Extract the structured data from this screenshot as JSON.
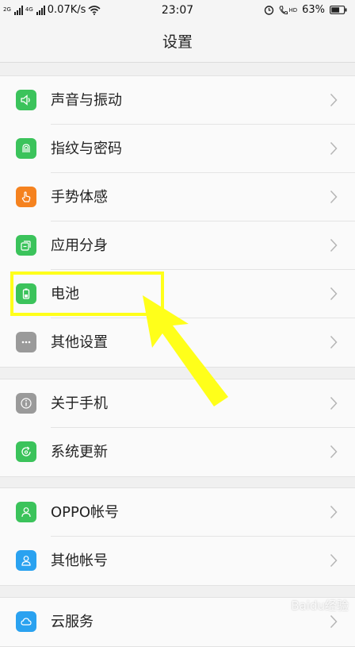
{
  "status_bar": {
    "net_small_1": "2G",
    "net_small_2": "4G",
    "speed": "0.07K/s",
    "time": "23:07",
    "battery": "63%",
    "hd_label": "HD"
  },
  "header": {
    "title": "设置"
  },
  "groups": [
    {
      "items": [
        {
          "label": "声音与振动",
          "icon": "speaker-icon",
          "color": "#3bc35b"
        },
        {
          "label": "指纹与密码",
          "icon": "fingerprint-icon",
          "color": "#3bc35b"
        },
        {
          "label": "手势体感",
          "icon": "gesture-hand-icon",
          "color": "#f5821f"
        },
        {
          "label": "应用分身",
          "icon": "app-clone-icon",
          "color": "#3bc35b"
        },
        {
          "label": "电池",
          "icon": "battery-icon",
          "color": "#3bc35b"
        },
        {
          "label": "其他设置",
          "icon": "more-dots-icon",
          "color": "#9a9a9a"
        }
      ]
    },
    {
      "items": [
        {
          "label": "关于手机",
          "icon": "info-icon",
          "color": "#9a9a9a"
        },
        {
          "label": "系统更新",
          "icon": "system-update-icon",
          "color": "#3bc35b"
        }
      ]
    },
    {
      "items": [
        {
          "label": "OPPO帐号",
          "icon": "person-icon",
          "color": "#3bc35b"
        },
        {
          "label": "其他帐号",
          "icon": "person-icon",
          "color": "#2aa2f0"
        }
      ]
    },
    {
      "items": [
        {
          "label": "云服务",
          "icon": "cloud-icon",
          "color": "#2aa2f0"
        }
      ]
    }
  ],
  "annotation_color": "#ffff1a",
  "watermark": "Baidu经验"
}
